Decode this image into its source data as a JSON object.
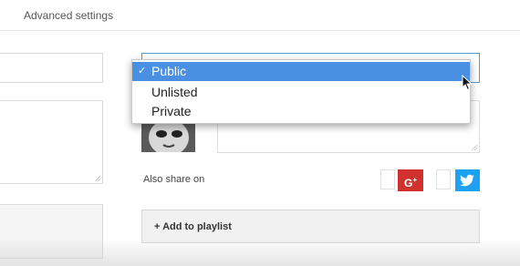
{
  "tabs": {
    "advanced_settings": "Advanced settings"
  },
  "privacy": {
    "options": [
      {
        "label": "Public",
        "selected": true,
        "check": "✓"
      },
      {
        "label": "Unlisted",
        "selected": false
      },
      {
        "label": "Private",
        "selected": false
      }
    ]
  },
  "share": {
    "label": "Also share on",
    "gplus_text": "G",
    "gplus_plus": "+",
    "gplus_color": "#d0312d",
    "twitter_color": "#1da1f2"
  },
  "playlist": {
    "add_label": "+ Add to playlist"
  },
  "colors": {
    "selection": "#4a90e2",
    "focus_border": "#5b9bd5"
  }
}
